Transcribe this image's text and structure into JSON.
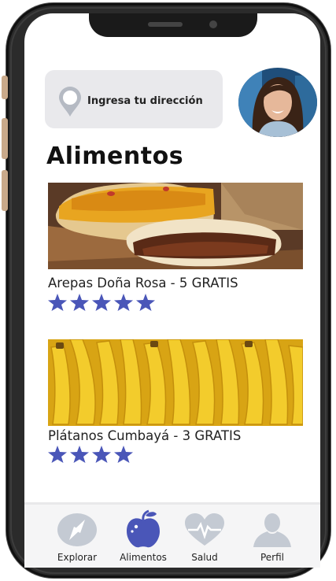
{
  "address": {
    "placeholder_text": "Ingresa tu dirección"
  },
  "section_title": "Alimentos",
  "items": [
    {
      "label": "Arepas Doña Rosa - 5 GRATIS",
      "rating": 5
    },
    {
      "label": "Plátanos Cumbayá - 3 GRATIS",
      "rating": 4
    }
  ],
  "tabs": [
    {
      "label": "Explorar",
      "icon": "compass-icon",
      "active": false
    },
    {
      "label": "Alimentos",
      "icon": "apple-icon",
      "active": true
    },
    {
      "label": "Salud",
      "icon": "heart-pulse-icon",
      "active": false
    },
    {
      "label": "Perfil",
      "icon": "user-icon",
      "active": false
    }
  ],
  "colors": {
    "accent": "#4a56b8",
    "star": "#4a56b8",
    "inactive_icon": "#c4cad3",
    "input_bg": "#e9e9ec"
  }
}
